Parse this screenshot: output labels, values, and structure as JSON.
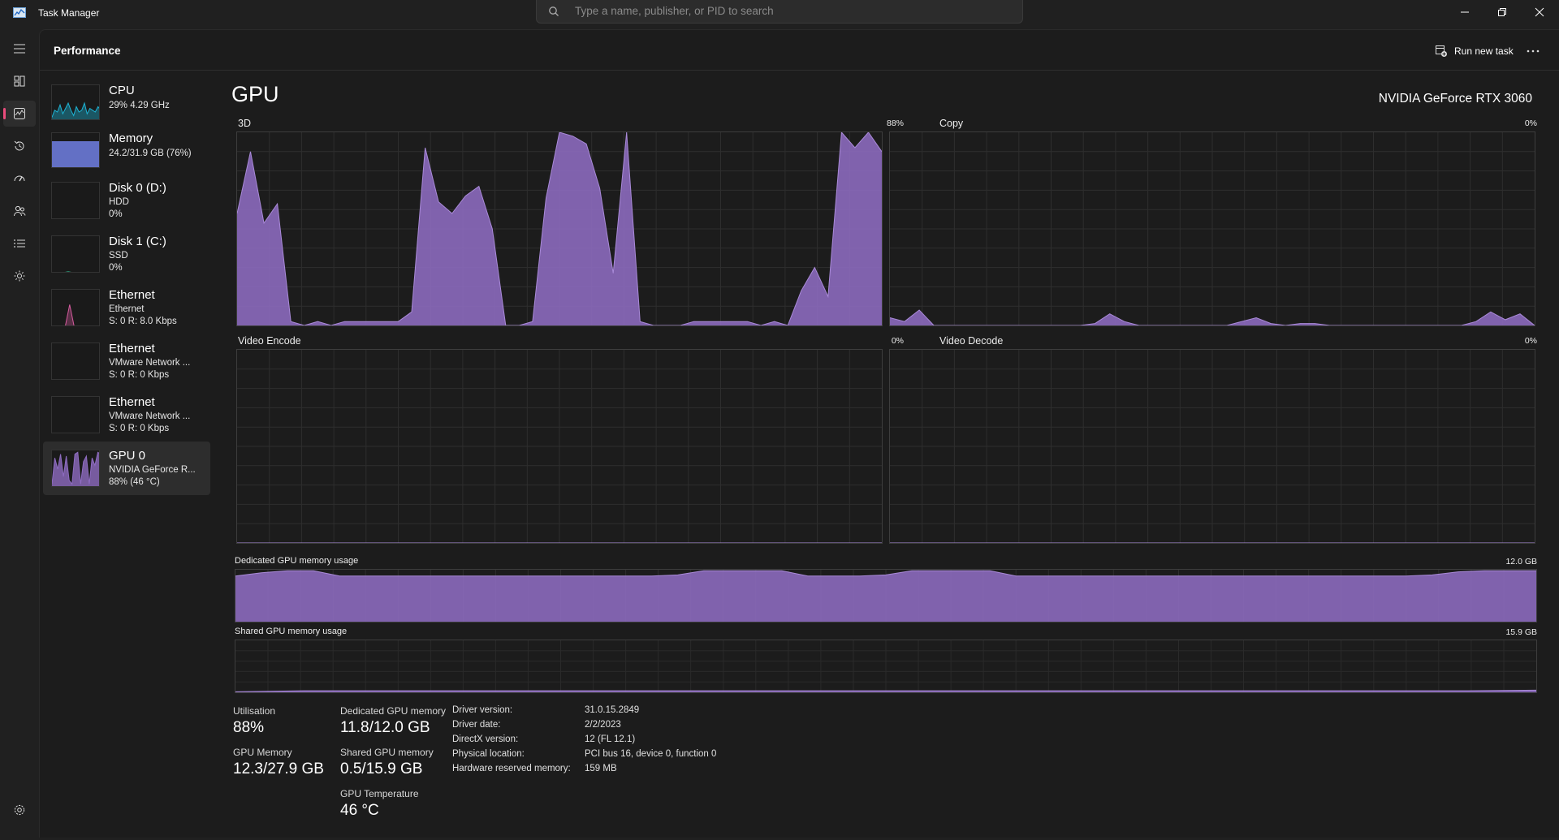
{
  "app": {
    "title": "Task Manager"
  },
  "search": {
    "placeholder": "Type a name, publisher, or PID to search"
  },
  "header": {
    "title": "Performance",
    "run_new_task": "Run new task"
  },
  "colors": {
    "gpu": "#8e6cc1",
    "cpu": "#1eb3d4",
    "memory": "#6f7ee0",
    "disk": "#2eaf8a",
    "ethernet": "#d65b9f",
    "rail_accent": "#ea4c7c"
  },
  "rail_icons": [
    "hamburger-menu-icon",
    "processes-icon",
    "performance-icon",
    "app-history-icon",
    "startup-apps-icon",
    "users-icon",
    "details-icon",
    "services-icon",
    "settings-icon"
  ],
  "sidebar": {
    "items": [
      {
        "title": "CPU",
        "l2": "29%  4.29 GHz",
        "l3": ""
      },
      {
        "title": "Memory",
        "l2": "24.2/31.9 GB (76%)",
        "l3": ""
      },
      {
        "title": "Disk 0 (D:)",
        "l2": "HDD",
        "l3": "0%"
      },
      {
        "title": "Disk 1 (C:)",
        "l2": "SSD",
        "l3": "0%"
      },
      {
        "title": "Ethernet",
        "l2": "Ethernet",
        "l3": "S: 0  R: 8.0 Kbps"
      },
      {
        "title": "Ethernet",
        "l2": "VMware Network ...",
        "l3": "S: 0  R: 0 Kbps"
      },
      {
        "title": "Ethernet",
        "l2": "VMware Network ...",
        "l3": "S: 0  R: 0 Kbps"
      },
      {
        "title": "GPU 0",
        "l2": "NVIDIA GeForce R...",
        "l3": "88%  (46 °C)"
      }
    ]
  },
  "gpu": {
    "title": "GPU",
    "name": "NVIDIA GeForce RTX 3060",
    "engines": [
      {
        "label": "3D",
        "value": "88%"
      },
      {
        "label": "Copy",
        "value": "0%"
      },
      {
        "label": "Video Encode",
        "value": "0%"
      },
      {
        "label": "Video Decode",
        "value": "0%"
      }
    ],
    "dedicated": {
      "label": "Dedicated GPU memory usage",
      "max": "12.0 GB"
    },
    "shared": {
      "label": "Shared GPU memory usage",
      "max": "15.9 GB"
    }
  },
  "series": {
    "engine_3d": [
      0.58,
      0.9,
      0.53,
      0.63,
      0.02,
      0,
      0.02,
      0,
      0.02,
      0.02,
      0.02,
      0.02,
      0.02,
      0.07,
      0.92,
      0.64,
      0.58,
      0.67,
      0.72,
      0.5,
      0,
      0,
      0.02,
      0.66,
      1,
      0.98,
      0.94,
      0.71,
      0.27,
      1,
      0.02,
      0,
      0,
      0,
      0.02,
      0.02,
      0.02,
      0.02,
      0.02,
      0,
      0.02,
      0,
      0.18,
      0.3,
      0.15,
      1,
      0.92,
      1,
      0.9
    ],
    "copy": [
      0.04,
      0.02,
      0.08,
      0,
      0,
      0,
      0,
      0,
      0,
      0,
      0,
      0,
      0,
      0,
      0.01,
      0.06,
      0.02,
      0,
      0,
      0,
      0,
      0,
      0,
      0,
      0.02,
      0.04,
      0.01,
      0,
      0.01,
      0.01,
      0,
      0,
      0,
      0,
      0,
      0,
      0,
      0,
      0,
      0,
      0.02,
      0.07,
      0.03,
      0.06,
      0
    ],
    "video_encode": [
      0,
      0,
      0,
      0,
      0
    ],
    "video_decode": [
      0,
      0,
      0,
      0,
      0
    ],
    "dedicated_mem": [
      0.88,
      0.94,
      0.98,
      0.98,
      0.88,
      0.88,
      0.88,
      0.88,
      0.88,
      0.88,
      0.88,
      0.88,
      0.88,
      0.88,
      0.88,
      0.88,
      0.88,
      0.9,
      0.98,
      0.98,
      0.98,
      0.98,
      0.88,
      0.88,
      0.88,
      0.9,
      0.98,
      0.98,
      0.98,
      0.98,
      0.88,
      0.88,
      0.88,
      0.88,
      0.88,
      0.88,
      0.88,
      0.88,
      0.88,
      0.88,
      0.88,
      0.88,
      0.88,
      0.88,
      0.88,
      0.88,
      0.9,
      0.96,
      0.98,
      0.98,
      0.98
    ],
    "shared_mem": [
      0.01,
      0.03,
      0.03,
      0.03,
      0.03,
      0.03,
      0.03,
      0.03,
      0.03,
      0.03,
      0.03,
      0.03,
      0.03,
      0.03,
      0.03,
      0.03,
      0.03,
      0.03,
      0.03,
      0.04
    ],
    "thumb_cpu": [
      0.1,
      0.3,
      0.25,
      0.45,
      0.2,
      0.35,
      0.5,
      0.3,
      0.15,
      0.4,
      0.25,
      0.3,
      0.5,
      0.2,
      0.35,
      0.3,
      0.25,
      0.4,
      0.3
    ],
    "thumb_mem": [
      0.76,
      0.76,
      0.76,
      0.76,
      0.76,
      0.76,
      0.76,
      0.76,
      0.76,
      0.76
    ],
    "thumb_disk1": [
      0.02,
      0.02,
      0.02,
      0.05,
      0.02,
      0.02,
      0.02,
      0.02,
      0.02,
      0.02
    ],
    "thumb_eth0": [
      0.02,
      0.02,
      0.02,
      0.02,
      0.6,
      0.02,
      0.02,
      0.02,
      0.02,
      0.02,
      0.02,
      0.02
    ],
    "thumb_gpu": [
      0.1,
      0.8,
      0.5,
      0.9,
      0.3,
      0.85,
      0.2,
      0.1,
      0.9,
      0.95,
      0.1,
      0.7,
      0.85,
      0.1,
      0.8,
      0.6,
      0.95,
      0.9
    ]
  },
  "stats": {
    "utilisation": {
      "label": "Utilisation",
      "value": "88%"
    },
    "gpu_memory": {
      "label": "GPU Memory",
      "value": "12.3/27.9 GB"
    },
    "dedicated": {
      "label": "Dedicated GPU memory",
      "value": "11.8/12.0 GB"
    },
    "shared": {
      "label": "Shared GPU memory",
      "value": "0.5/15.9 GB"
    },
    "temperature": {
      "label": "GPU Temperature",
      "value": "46 °C"
    },
    "info": [
      {
        "k": "Driver version:",
        "v": "31.0.15.2849"
      },
      {
        "k": "Driver date:",
        "v": "2/2/2023"
      },
      {
        "k": "DirectX version:",
        "v": "12 (FL 12.1)"
      },
      {
        "k": "Physical location:",
        "v": "PCI bus 16, device 0, function 0"
      },
      {
        "k": "Hardware reserved memory:",
        "v": "159 MB"
      }
    ]
  }
}
